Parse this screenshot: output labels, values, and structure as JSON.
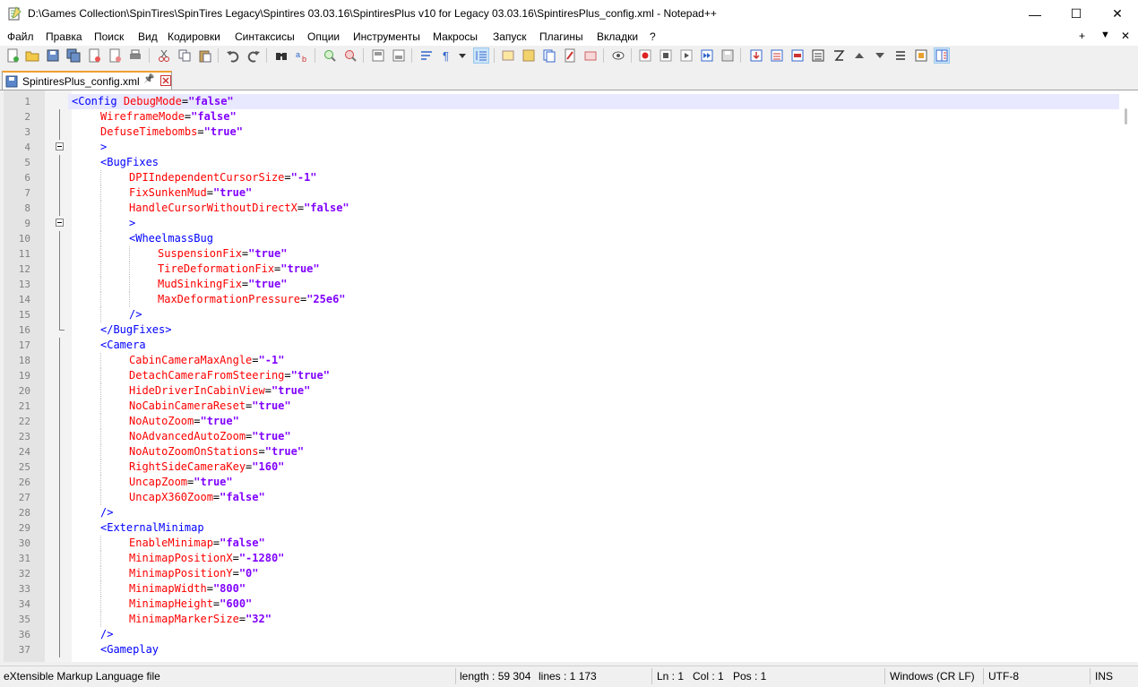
{
  "window": {
    "title": "D:\\Games Collection\\SpinTires\\SpinTires Legacy\\Spintires 03.03.16\\SpintiresPlus v10 for Legacy 03.03.16\\SpintiresPlus_config.xml - Notepad++",
    "minimize": "—",
    "maximize": "☐",
    "close": "✕"
  },
  "menu": {
    "items": [
      "Файл",
      "Правка",
      "Поиск",
      "Вид",
      "Кодировки",
      "Синтаксисы",
      "Опции",
      "Инструменты",
      "Макросы",
      "Запуск",
      "Плагины",
      "Вкладки",
      "?"
    ],
    "plus": "+",
    "down": "▼",
    "close": "✕"
  },
  "tab": {
    "label": "SpintiresPlus_config.xml",
    "pin": "📌"
  },
  "colors": {
    "tag": "#0000ff",
    "attribute": "#ff0000",
    "value": "#8000ff",
    "current_line": "#e8e8ff",
    "tab_accent": "#f0a030"
  },
  "editor": {
    "lines": [
      {
        "n": "1",
        "indent": 0,
        "tag": "<Config",
        "attr": "DebugMode",
        "val": "\"false\""
      },
      {
        "n": "2",
        "indent": 1,
        "attr": "WireframeMode",
        "val": "\"false\""
      },
      {
        "n": "3",
        "indent": 1,
        "attr": "DefuseTimebombs",
        "val": "\"true\""
      },
      {
        "n": "4",
        "indent": 1,
        "tag": ">"
      },
      {
        "n": "5",
        "indent": 1,
        "tag": "<BugFixes"
      },
      {
        "n": "6",
        "indent": 2,
        "attr": "DPIIndependentCursorSize",
        "val": "\"-1\""
      },
      {
        "n": "7",
        "indent": 2,
        "attr": "FixSunkenMud",
        "val": "\"true\""
      },
      {
        "n": "8",
        "indent": 2,
        "attr": "HandleCursorWithoutDirectX",
        "val": "\"false\""
      },
      {
        "n": "9",
        "indent": 2,
        "tag": ">"
      },
      {
        "n": "10",
        "indent": 2,
        "tag": "<WheelmassBug"
      },
      {
        "n": "11",
        "indent": 3,
        "attr": "SuspensionFix",
        "val": "\"true\""
      },
      {
        "n": "12",
        "indent": 3,
        "attr": "TireDeformationFix",
        "val": "\"true\""
      },
      {
        "n": "13",
        "indent": 3,
        "attr": "MudSinkingFix",
        "val": "\"true\""
      },
      {
        "n": "14",
        "indent": 3,
        "attr": "MaxDeformationPressure",
        "val": "\"25e6\""
      },
      {
        "n": "15",
        "indent": 2,
        "tag": "/>"
      },
      {
        "n": "16",
        "indent": 1,
        "tag": "</BugFixes>"
      },
      {
        "n": "17",
        "indent": 1,
        "tag": "<Camera"
      },
      {
        "n": "18",
        "indent": 2,
        "attr": "CabinCameraMaxAngle",
        "val": "\"-1\""
      },
      {
        "n": "19",
        "indent": 2,
        "attr": "DetachCameraFromSteering",
        "val": "\"true\""
      },
      {
        "n": "20",
        "indent": 2,
        "attr": "HideDriverInCabinView",
        "val": "\"true\""
      },
      {
        "n": "21",
        "indent": 2,
        "attr": "NoCabinCameraReset",
        "val": "\"true\""
      },
      {
        "n": "22",
        "indent": 2,
        "attr": "NoAutoZoom",
        "val": "\"true\""
      },
      {
        "n": "23",
        "indent": 2,
        "attr": "NoAdvancedAutoZoom",
        "val": "\"true\""
      },
      {
        "n": "24",
        "indent": 2,
        "attr": "NoAutoZoomOnStations",
        "val": "\"true\""
      },
      {
        "n": "25",
        "indent": 2,
        "attr": "RightSideCameraKey",
        "val": "\"160\""
      },
      {
        "n": "26",
        "indent": 2,
        "attr": "UncapZoom",
        "val": "\"true\""
      },
      {
        "n": "27",
        "indent": 2,
        "attr": "UncapX360Zoom",
        "val": "\"false\""
      },
      {
        "n": "28",
        "indent": 1,
        "tag": "/>"
      },
      {
        "n": "29",
        "indent": 1,
        "tag": "<ExternalMinimap"
      },
      {
        "n": "30",
        "indent": 2,
        "attr": "EnableMinimap",
        "val": "\"false\""
      },
      {
        "n": "31",
        "indent": 2,
        "attr": "MinimapPositionX",
        "val": "\"-1280\""
      },
      {
        "n": "32",
        "indent": 2,
        "attr": "MinimapPositionY",
        "val": "\"0\""
      },
      {
        "n": "33",
        "indent": 2,
        "attr": "MinimapWidth",
        "val": "\"800\""
      },
      {
        "n": "34",
        "indent": 2,
        "attr": "MinimapHeight",
        "val": "\"600\""
      },
      {
        "n": "35",
        "indent": 2,
        "attr": "MinimapMarkerSize",
        "val": "\"32\""
      },
      {
        "n": "36",
        "indent": 1,
        "tag": "/>"
      },
      {
        "n": "37",
        "indent": 1,
        "tag": "<Gameplay"
      }
    ]
  },
  "status": {
    "filetype": "eXtensible Markup Language file",
    "length": "length : 59 304",
    "lines": "lines : 1 173",
    "ln": "Ln : 1",
    "col": "Col : 1",
    "pos": "Pos : 1",
    "eol": "Windows (CR LF)",
    "encoding": "UTF-8",
    "mode": "INS"
  }
}
